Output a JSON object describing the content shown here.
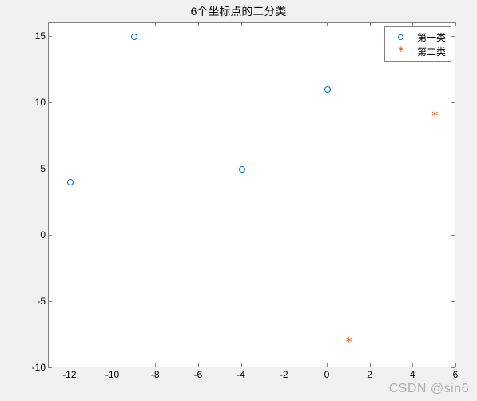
{
  "chart_data": {
    "type": "scatter",
    "title": "6个坐标点的二分类",
    "xlabel": "",
    "ylabel": "",
    "xlim": [
      -13,
      6
    ],
    "ylim": [
      -10,
      16
    ],
    "xticks": [
      -12,
      -10,
      -8,
      -6,
      -4,
      -2,
      0,
      2,
      4,
      6
    ],
    "yticks": [
      -10,
      -5,
      0,
      5,
      10,
      15
    ],
    "series": [
      {
        "name": "第一类",
        "marker": "o",
        "color": "#0072BD",
        "points": [
          {
            "x": -12,
            "y": 4
          },
          {
            "x": -9,
            "y": 15
          },
          {
            "x": -4,
            "y": 5
          },
          {
            "x": 0,
            "y": 11
          }
        ]
      },
      {
        "name": "第二类",
        "marker": "*",
        "color": "#D95319",
        "points": [
          {
            "x": 1,
            "y": -8
          },
          {
            "x": 5,
            "y": 9
          }
        ]
      }
    ],
    "legend_position": "northeast"
  },
  "watermark": "CSDN @sin6"
}
